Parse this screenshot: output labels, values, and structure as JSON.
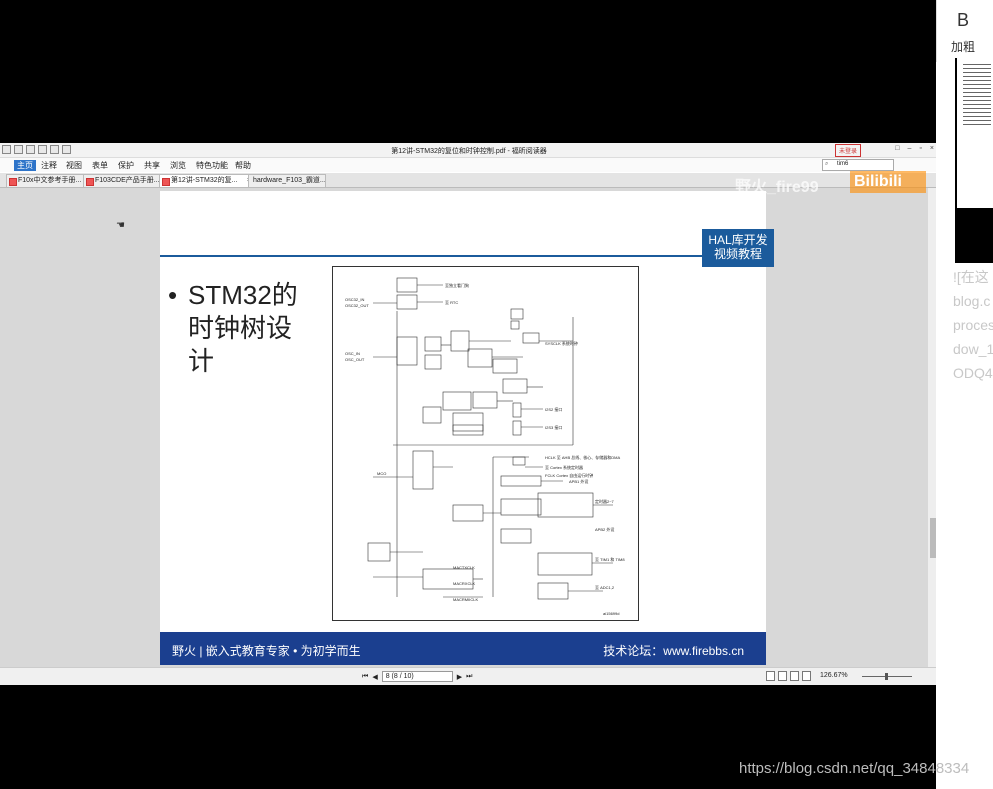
{
  "reader": {
    "title": "第12讲-STM32的复位和时钟控制.pdf - 福昕阅读器",
    "login_label": "未登录",
    "window_buttons": [
      "□",
      "–",
      "▫",
      "×"
    ],
    "menu": [
      "主页",
      "注释",
      "视图",
      "表单",
      "保护",
      "共享",
      "浏览",
      "特色功能",
      "帮助"
    ],
    "search_value": "tim6",
    "tabs": [
      {
        "label": "F10x中文参考手册..."
      },
      {
        "label": "F103CDE产品手册..."
      },
      {
        "label": "第12讲-STM32的复...",
        "close": "×"
      },
      {
        "label": "hardware_F103_霸道..."
      }
    ]
  },
  "slide": {
    "badge_line1": "HAL库开发",
    "badge_line2": "视频教程",
    "bullet": "•",
    "heading": "STM32的时钟树设计",
    "footer_left": "野火 | 嵌入式教育专家 • 为初学而生",
    "footer_right": "技术论坛：www.firebbs.cn",
    "diagram_labels": {
      "adcclk": "至独立看门狗",
      "rtc": "至 RTC",
      "hse_osc": "OSC32_IN",
      "hse_osc2": "OSC32_OUT",
      "osc_in": "OSC_IN",
      "osc_out": "OSC_OUT",
      "sysclk": "SYSCLK 系统时钟",
      "i2s2": "I2S2 接口",
      "i2s3": "I2S3 接口",
      "mco": "MCO",
      "hclk": "HCLK 至 AHB 总线、核心、存储器和DMA",
      "cortex": "至 Cortex 系统定时器",
      "fclk": "FCLK Cortex 自由运行时钟",
      "apb1_per": "APB1 外设",
      "timers27": "定时器2~7",
      "apb2_per": "APB2 外设",
      "tim18": "至 TIM1 和 TIM8",
      "adc": "至 ADC1,2",
      "mac": "MACTXCLK",
      "macrx": "MACRXCLK",
      "macrmii": "MACRMIICLK",
      "footer_id": "ai15699d"
    }
  },
  "status": {
    "page_box": "8 (8 / 10)",
    "zoom": "126.67%"
  },
  "right": {
    "b_label": "B",
    "cu_label": "加粗",
    "side_lines": [
      "![在这",
      "blog.c",
      "proces",
      "dow_1",
      "ODQ4"
    ]
  },
  "overlays": {
    "uploader": "野火_fire99",
    "bilibili": "Bilibili",
    "csdn": "https://blog.csdn.net/qq_34848334"
  },
  "colors": {
    "slide_blue": "#1b5b9c",
    "footer_blue": "#1b3f8f",
    "active_menu": "#2e74c9"
  }
}
